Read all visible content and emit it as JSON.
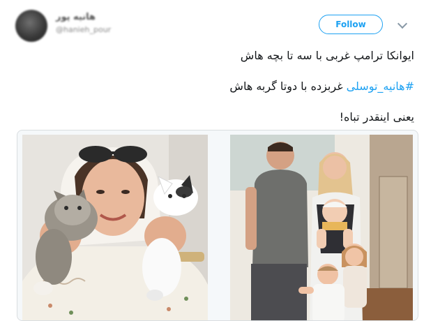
{
  "tweet": {
    "author_name": "هانیه پور",
    "author_handle": "@hanieh_pour",
    "follow_label": "Follow",
    "text_line_1": "ایوانکا ترامپ غربی با سه تا بچه هاش",
    "hashtag": "#هانیه_توسلی",
    "text_line_2_rest": " غربزده با دوتا گربه هاش",
    "text_line_3": "یعنی اینقدر تباه!"
  },
  "colors": {
    "accent": "#1da1f2",
    "text": "#14171a",
    "border": "#d9dde0"
  },
  "icons": {
    "more_options": "chevron-down-icon"
  }
}
